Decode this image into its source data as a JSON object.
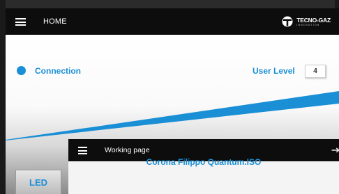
{
  "header": {
    "title": "HOME",
    "brand_name": "TECNO-GAZ",
    "brand_tagline": "INNOVATION",
    "menu_icon": "hamburger-menu-icon",
    "brand_icon": "tecnogaz-logo-icon"
  },
  "status": {
    "connection_label": "Connection",
    "connection_color": "#1a8fd6",
    "user_level_label": "User Level",
    "user_level_value": "4"
  },
  "buttons": {
    "led_label": "LED"
  },
  "sub_window": {
    "title": "Working page",
    "menu_icon": "hamburger-menu-icon",
    "device_name": "Corona Filippo Quantum.ISO",
    "device_name_2": ""
  },
  "colors": {
    "accent": "#1a8fd6",
    "topbar": "#0d0d0d"
  }
}
